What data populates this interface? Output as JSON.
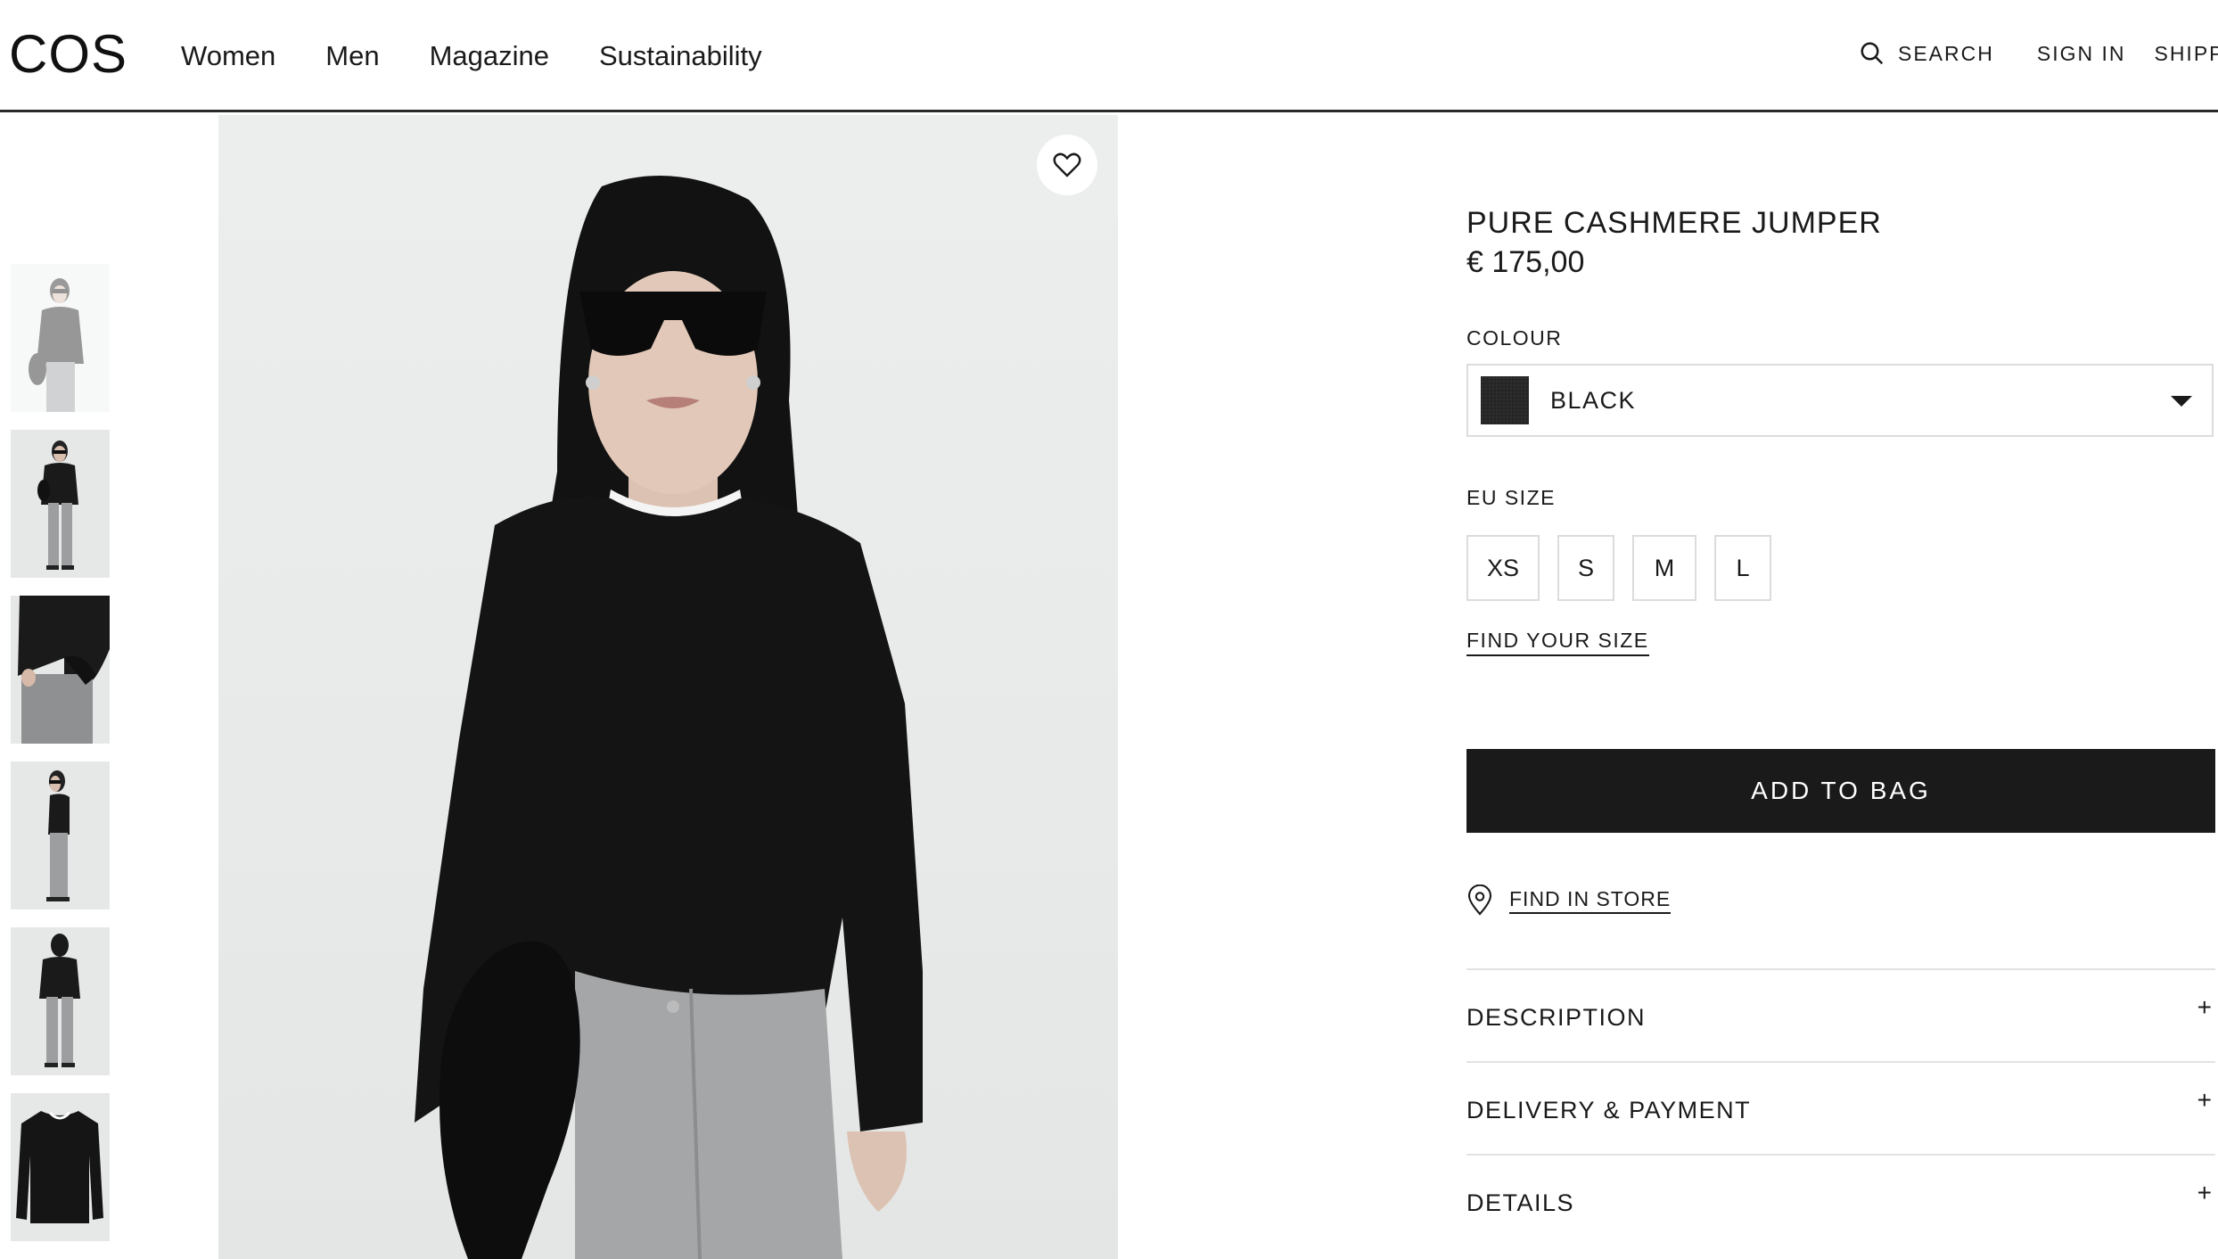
{
  "header": {
    "logo": "COS",
    "nav": [
      "Women",
      "Men",
      "Magazine",
      "Sustainability"
    ],
    "search_label": "SEARCH",
    "sign_in_label": "SIGN IN",
    "shipping_label": "SHIPPI"
  },
  "gallery": {
    "thumbnails": [
      "front-full",
      "front-full-bag",
      "detail-sleeve",
      "side-full",
      "back-full",
      "flat-lay"
    ],
    "selected_index": 0
  },
  "product": {
    "title": "PURE CASHMERE JUMPER",
    "price": "€ 175,00",
    "colour_label": "COLOUR",
    "colour_value": "BLACK",
    "colour_swatch": "#262626",
    "size_label": "EU SIZE",
    "sizes": [
      "XS",
      "S",
      "M",
      "L"
    ],
    "find_your_size": "FIND YOUR SIZE",
    "add_to_bag": "ADD TO BAG",
    "find_in_store": "FIND IN STORE",
    "accordion": [
      "DESCRIPTION",
      "DELIVERY & PAYMENT",
      "DETAILS"
    ],
    "accordion_icon": "+"
  },
  "colors": {
    "button_bg": "#1a1a1a",
    "border": "#dcdcdc",
    "image_bg": "#eceeee"
  },
  "icons": [
    "search-icon",
    "heart-icon",
    "location-pin-icon",
    "chevron-down-icon",
    "plus-icon"
  ]
}
